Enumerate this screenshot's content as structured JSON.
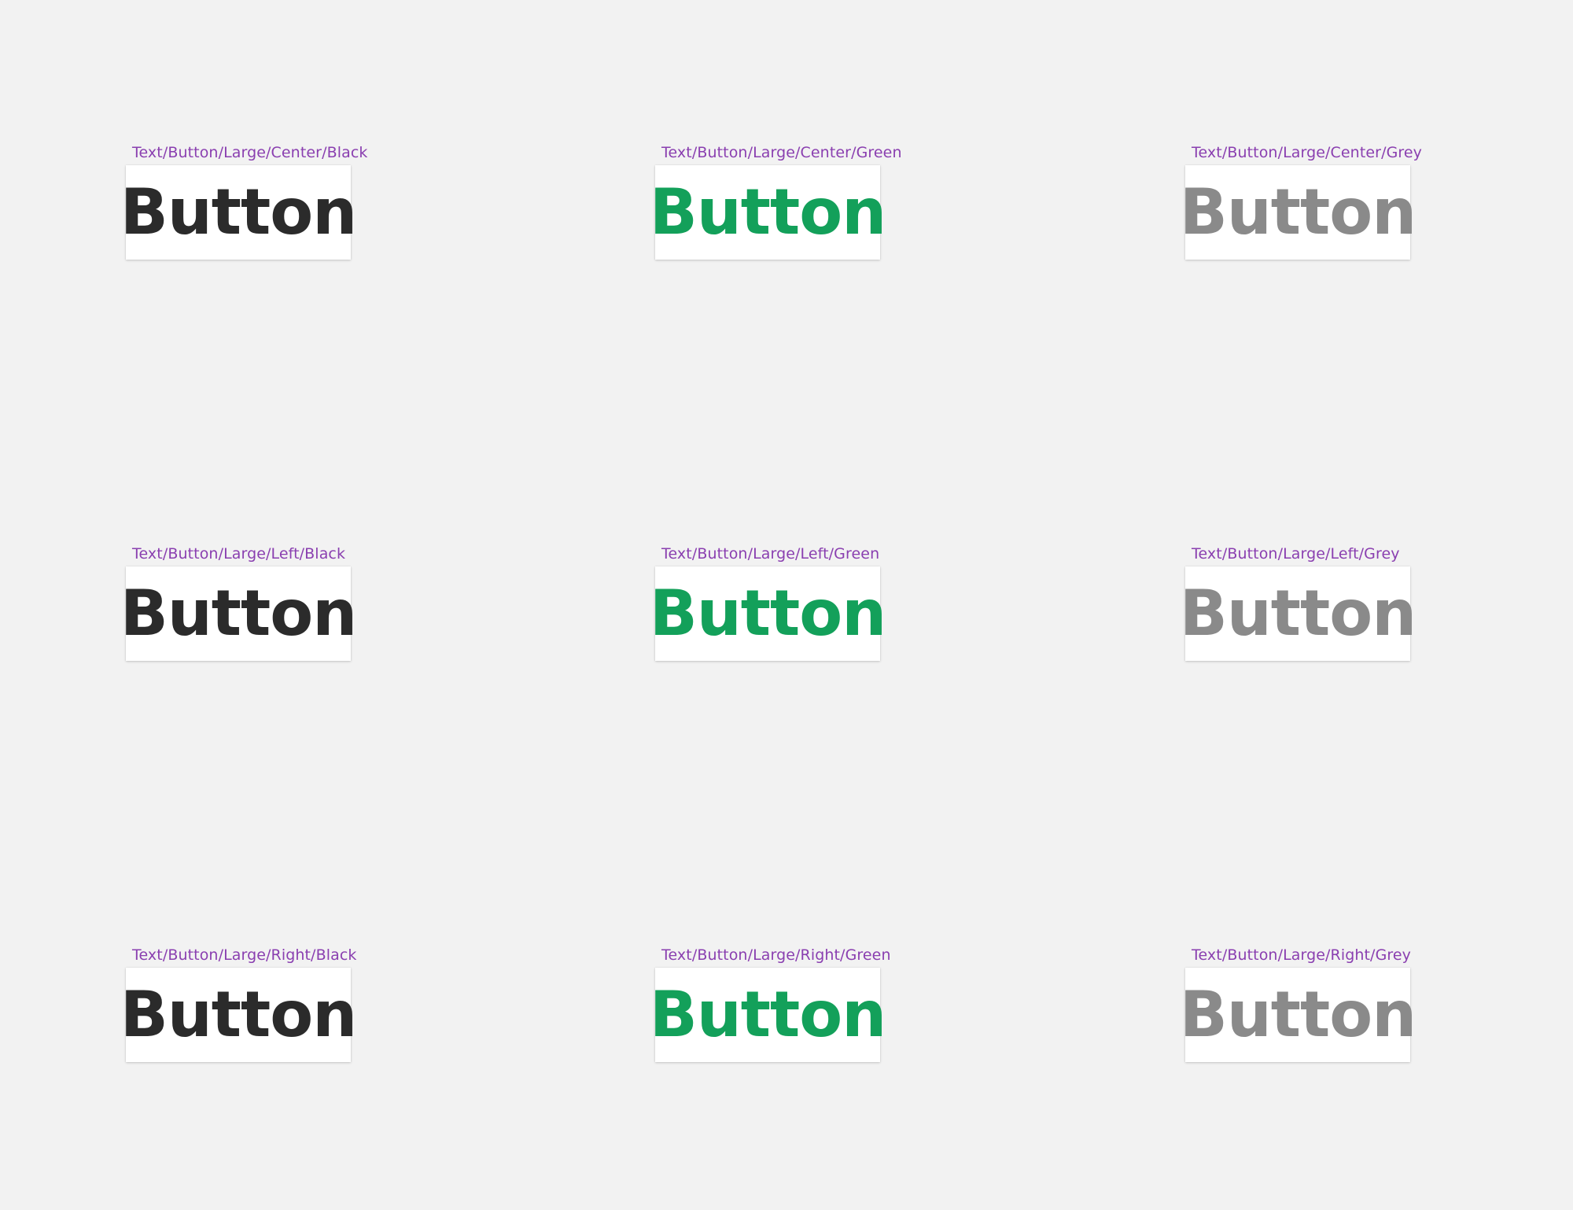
{
  "colors": {
    "background": "#f2f2f2",
    "label": "#8a3fb0",
    "black": "#2b2b2b",
    "green": "#13a05a",
    "grey": "#8a8a8a"
  },
  "components": [
    {
      "label": "Text/Button/Large/Center/Black",
      "text": "Button",
      "color": "#2b2b2b"
    },
    {
      "label": "Text/Button/Large/Center/Green",
      "text": "Button",
      "color": "#13a05a"
    },
    {
      "label": "Text/Button/Large/Center/Grey",
      "text": "Button",
      "color": "#8a8a8a"
    },
    {
      "label": "Text/Button/Large/Left/Black",
      "text": "Button",
      "color": "#2b2b2b"
    },
    {
      "label": "Text/Button/Large/Left/Green",
      "text": "Button",
      "color": "#13a05a"
    },
    {
      "label": "Text/Button/Large/Left/Grey",
      "text": "Button",
      "color": "#8a8a8a"
    },
    {
      "label": "Text/Button/Large/Right/Black",
      "text": "Button",
      "color": "#2b2b2b"
    },
    {
      "label": "Text/Button/Large/Right/Green",
      "text": "Button",
      "color": "#13a05a"
    },
    {
      "label": "Text/Button/Large/Right/Grey",
      "text": "Button",
      "color": "#8a8a8a"
    }
  ]
}
